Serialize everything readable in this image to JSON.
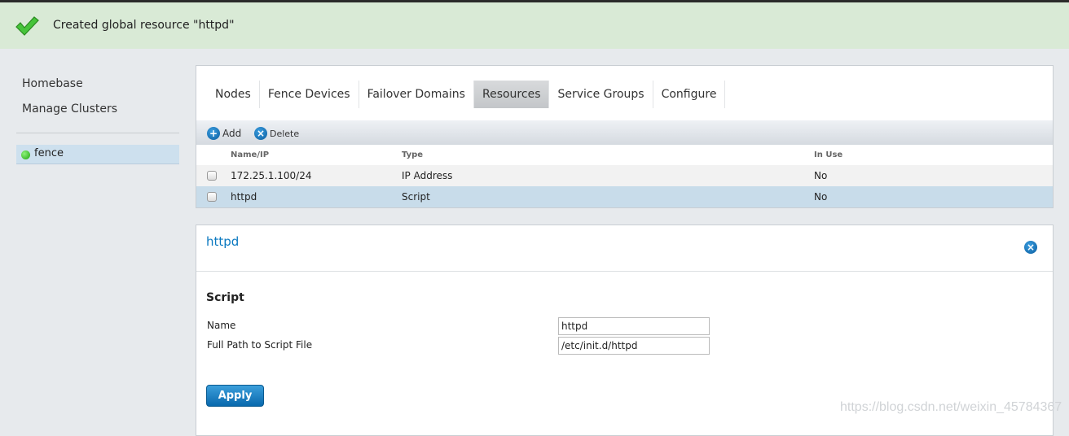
{
  "notification": {
    "message": "Created global resource \"httpd\"",
    "icon": "checkmark-icon"
  },
  "sidebar": {
    "items": [
      {
        "label": "Homebase"
      },
      {
        "label": "Manage Clusters"
      }
    ],
    "clusters": [
      {
        "name": "fence",
        "status": "online",
        "status_color": "#1fa50f"
      }
    ]
  },
  "tabs": [
    {
      "label": "Nodes"
    },
    {
      "label": "Fence Devices"
    },
    {
      "label": "Failover Domains"
    },
    {
      "label": "Resources",
      "active": true
    },
    {
      "label": "Service Groups"
    },
    {
      "label": "Configure"
    }
  ],
  "toolbar": {
    "add_label": "Add",
    "delete_label": "Delete"
  },
  "table": {
    "columns": [
      "Name/IP",
      "Type",
      "In Use"
    ],
    "rows": [
      {
        "name": "172.25.1.100/24",
        "type": "IP Address",
        "in_use": "No",
        "selected": false
      },
      {
        "name": "httpd",
        "type": "Script",
        "in_use": "No",
        "selected": true
      }
    ]
  },
  "detail": {
    "title": "httpd",
    "section": "Script",
    "fields": [
      {
        "label": "Name",
        "value": "httpd"
      },
      {
        "label": "Full Path to Script File",
        "value": "/etc/init.d/httpd"
      }
    ],
    "apply_label": "Apply"
  },
  "watermark": "https://blog.csdn.net/weixin_45784367",
  "colors": {
    "accent": "#0b79c0",
    "selected_row": "#c8dcea",
    "banner": "#d9ead6"
  }
}
